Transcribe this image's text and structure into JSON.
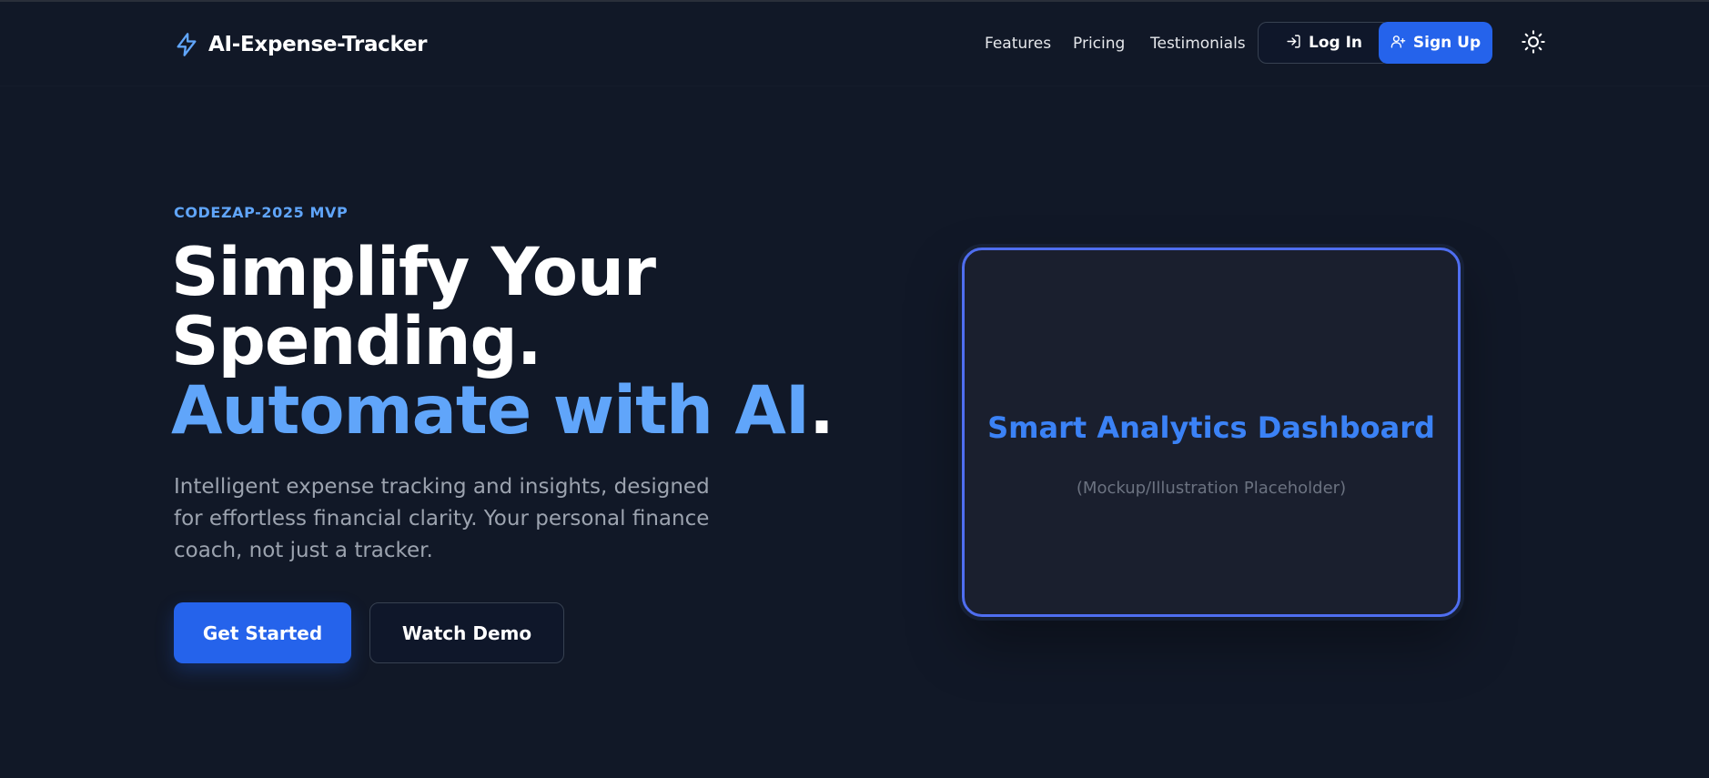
{
  "header": {
    "brand_name": "AI-Expense-Tracker",
    "brand_icon": "lightning-bolt-icon",
    "nav_links": [
      "Features",
      "Pricing",
      "Testimonials"
    ],
    "login_label": "Log In",
    "login_icon": "login-arrow-icon",
    "signup_label": "Sign Up",
    "signup_icon": "user-plus-icon",
    "theme_icon": "sun-icon"
  },
  "hero": {
    "eyebrow": "CODEZAP-2025 MVP",
    "headline_part1": "Simplify Your Spending. ",
    "headline_accent": "Automate with AI",
    "headline_end": ".",
    "subtext": "Intelligent expense tracking and insights, designed for effortless financial clarity. Your personal finance coach, not just a tracker.",
    "primary_cta": "Get Started",
    "secondary_cta": "Watch Demo"
  },
  "mockup": {
    "title": "Smart Analytics Dashboard",
    "subtitle": "(Mockup/Illustration Placeholder)"
  },
  "colors": {
    "background": "#111827",
    "accent": "#60a5fa",
    "primary_button": "#2563eb",
    "mockup_border": "#4f6ef0",
    "mockup_title": "#3b82f6"
  }
}
